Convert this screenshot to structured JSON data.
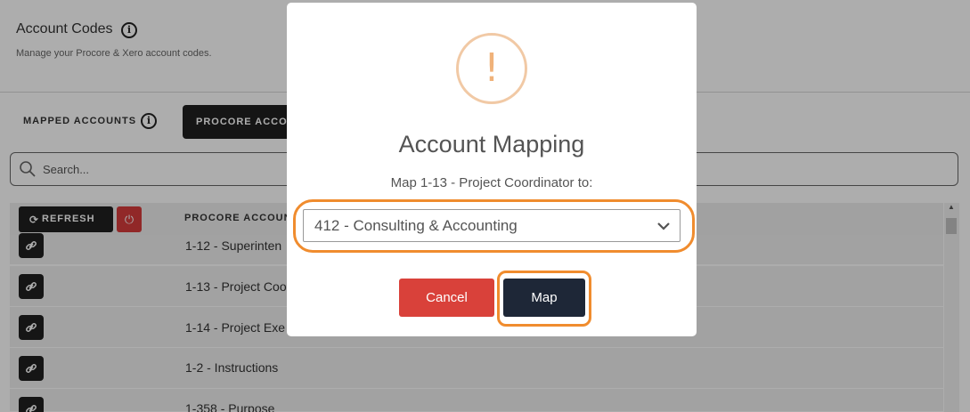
{
  "header": {
    "title": "Account Codes",
    "subtitle": "Manage your Procore & Xero account codes."
  },
  "tabs": {
    "mapped": "MAPPED ACCOUNTS",
    "procore": "PROCORE ACCOU"
  },
  "search": {
    "placeholder": "Search..."
  },
  "table": {
    "refresh_label": "REFRESH",
    "column_header": "PROCORE ACCOUNT",
    "rows": [
      {
        "label": "1-12 - Superinten"
      },
      {
        "label": "1-13 - Project Coo"
      },
      {
        "label": "1-14 - Project Exe"
      },
      {
        "label": "1-2 - Instructions"
      },
      {
        "label": "1-358 - Purpose"
      }
    ]
  },
  "modal": {
    "icon": "exclamation-icon",
    "title": "Account Mapping",
    "message": "Map 1-13 - Project Coordinator to:",
    "select_value": "412 - Consulting & Accounting",
    "cancel_label": "Cancel",
    "map_label": "Map"
  },
  "colors": {
    "highlight": "#f08c2e",
    "cancel": "#d9413a",
    "map": "#1e2737",
    "dark_button": "#1f1f1f"
  }
}
